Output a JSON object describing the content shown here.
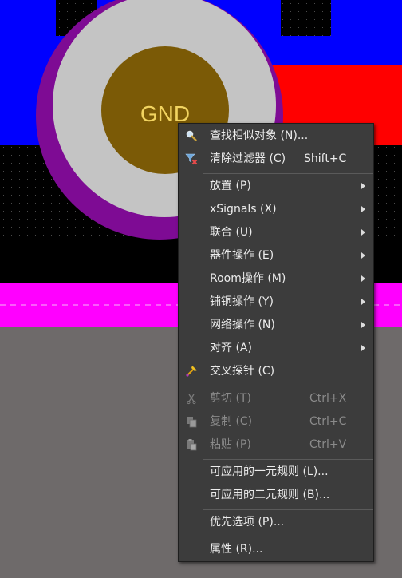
{
  "pcb": {
    "net_label": "GND",
    "colors": {
      "background": "#000000",
      "dot_grid": "#4a4a4a",
      "top_copper": "#0000ff",
      "bottom_copper": "#ff0000",
      "solder_mask_ring": "#7e0b94",
      "pad": "#c4c4c4",
      "hole": "#7b5a06",
      "net_label": "#f2d460",
      "silkscreen": "#ff00ff",
      "board_outline": "#6e6a6a"
    }
  },
  "context_menu": {
    "items": [
      {
        "label": "查找相似对象 (N)...",
        "icon": "search-icon"
      },
      {
        "label": "清除过滤器 (C)",
        "shortcut": "Shift+C",
        "icon": "clear-filter-icon"
      },
      {
        "label": "放置 (P)",
        "submenu": true
      },
      {
        "label": "xSignals (X)",
        "submenu": true
      },
      {
        "label": "联合 (U)",
        "submenu": true
      },
      {
        "label": "器件操作 (E)",
        "submenu": true
      },
      {
        "label": "Room操作 (M)",
        "submenu": true
      },
      {
        "label": "铺铜操作 (Y)",
        "submenu": true
      },
      {
        "label": "网络操作 (N)",
        "submenu": true
      },
      {
        "label": "对齐 (A)",
        "submenu": true
      },
      {
        "label": "交叉探针 (C)",
        "icon": "cross-probe-icon"
      },
      {
        "label": "剪切 (T)",
        "shortcut": "Ctrl+X",
        "icon": "cut-icon",
        "disabled": true
      },
      {
        "label": "复制 (C)",
        "shortcut": "Ctrl+C",
        "icon": "copy-icon",
        "disabled": true
      },
      {
        "label": "粘贴 (P)",
        "shortcut": "Ctrl+V",
        "icon": "paste-icon",
        "disabled": true
      },
      {
        "label": "可应用的一元规则 (L)..."
      },
      {
        "label": "可应用的二元规则 (B)..."
      },
      {
        "label": "优先选项 (P)..."
      },
      {
        "label": "属性 (R)..."
      }
    ]
  }
}
